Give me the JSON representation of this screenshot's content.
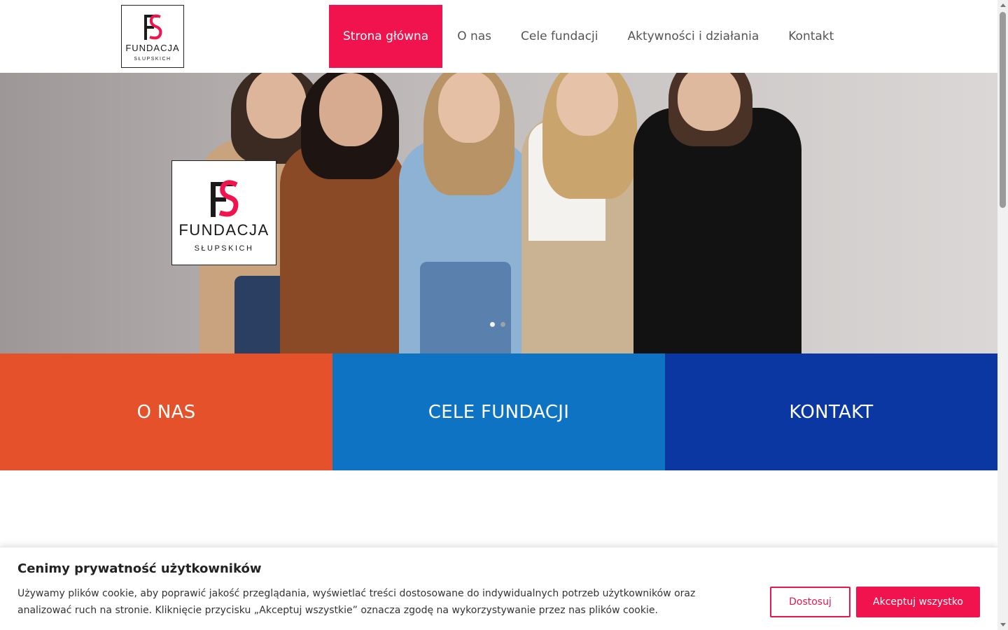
{
  "header": {
    "logo_text": "FUNDACJA",
    "logo_subtext": "SŁUPSKICH",
    "logo_letters": "FS",
    "nav": [
      {
        "label": "Strona główna",
        "active": true
      },
      {
        "label": "O nas",
        "active": false
      },
      {
        "label": "Cele fundacji",
        "active": false
      },
      {
        "label": "Aktywności i działania",
        "active": false
      },
      {
        "label": "Kontakt",
        "active": false
      }
    ]
  },
  "hero": {
    "logo_text": "FUNDACJA",
    "logo_subtext": "SŁUPSKICH",
    "slide_count": 2,
    "active_slide": 1
  },
  "tiles": [
    {
      "label": "O NAS",
      "color": "#e5512a"
    },
    {
      "label": "CELE FUNDACJI",
      "color": "#0f73c4"
    },
    {
      "label": "KONTAKT",
      "color": "#0a37a1"
    }
  ],
  "cookie": {
    "title": "Cenimy prywatność użytkowników",
    "text": "Używamy plików cookie, aby poprawić jakość przeglądania, wyświetlać treści dostosowane do indywidualnych potrzeb użytkowników oraz analizować ruch na stronie. Kliknięcie przycisku „Akceptuj wszystkie” oznacza zgodę na wykorzystywanie przez nas plików cookie.",
    "customize_label": "Dostosuj",
    "accept_label": "Akceptuj wszystko"
  },
  "colors": {
    "accent": "#f0134d",
    "logo_black": "#1a1a1a",
    "logo_red": "#f0134d"
  }
}
